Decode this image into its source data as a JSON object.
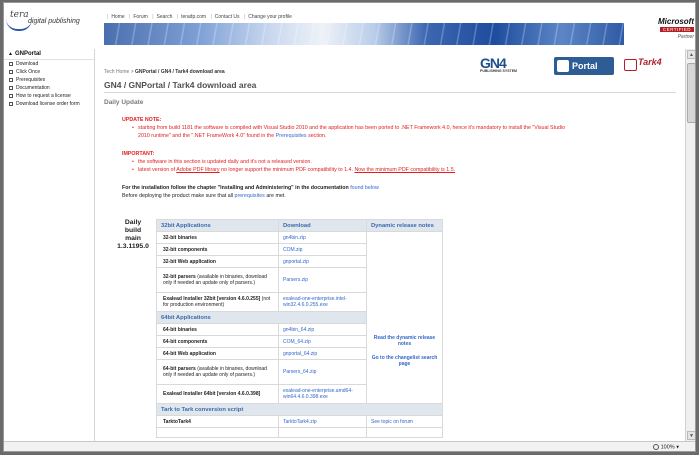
{
  "header": {
    "logo_top": "tera",
    "logo_bottom": "digital publishing",
    "nav": [
      "Home",
      "Forum",
      "Search",
      "teradp.com",
      "Contact Us",
      "Change your profile"
    ],
    "ms_brand": "Microsoft",
    "ms_certified": "CERTIFIED",
    "ms_partner": "Partner"
  },
  "sidebar": {
    "title": "GNPortal",
    "items": [
      "Download",
      "Click Once",
      "Prerequisites",
      "Documentation",
      "How to request a license",
      "Download license order form"
    ]
  },
  "breadcrumb": {
    "root": "Tech Home",
    "sep": ">",
    "current": "GNPortal / GN4 / Tark4 download area"
  },
  "product_logos": {
    "gn4": "GN4",
    "gn4_sub": "PUBLISHING SYSTEM",
    "portal": "Portal",
    "tark": "Tark4"
  },
  "page": {
    "title": "GN4 / GNPortal / Tark4 download area",
    "subtitle": "Daily Update"
  },
  "update_note": {
    "heading": "UPDATE NOTE:",
    "line1_pre": "starting from build 1181 the software is compiled with Visual Studio 2010 and the application has been ported to .NET Framework 4.0, hence it's mandatory to install the \"Visual Studio",
    "line2_pre": "2010 runtime\" and the \".NET FrameWork 4.0\" found in the",
    "line2_link": "Prerequisites",
    "line2_post": "section."
  },
  "important": {
    "heading": "IMPORTANT:",
    "item1": "the software in this section is updated daily and it's not a released version.",
    "item2_pre": "latest version of",
    "item2_link": "Adobe PDF library",
    "item2_mid": "no longer support the minimum PDF compatibility to 1.4.",
    "item2_underlined": "Now the minimum PDF compatibility is 1.5."
  },
  "instructions": {
    "line1": "For the installation follow the chapter \"Installing and Administering\" in the documentation",
    "line1_link": "found below",
    "line2_pre": "Before deploying the product make sure that all",
    "line2_link": "prerequisites",
    "line2_post": "are met."
  },
  "daily_build": {
    "line1": "Daily",
    "line2": "build",
    "line3": "main",
    "version": "1.3.1195.0"
  },
  "downloads": {
    "col_apps": "32bit Applications",
    "col_download": "Download",
    "col_notes": "Dynamic release notes",
    "notes_link1": "Read the dynamic release notes",
    "notes_link2": "Go to the changelist search page",
    "rows32": [
      {
        "label": "32-bit binaries",
        "note": "",
        "file": "gn4bin.zip"
      },
      {
        "label": "32-bit components",
        "note": "",
        "file": "COM.zip"
      },
      {
        "label": "32-bit Web application",
        "note": "",
        "file": "gnportal.zip"
      },
      {
        "label": "32-bit parsers",
        "note": "(available in binaries, download only if needed an update only of parsers.)",
        "file": "Parsers.zip"
      },
      {
        "label": "Exalead Installer 32bit [version 4.6.0.255]",
        "note": "(not for production environment)",
        "file": "exalead-one-enterprise.intel-win32.4.6.0.255.exe"
      }
    ],
    "section64": "64bit Applications",
    "rows64": [
      {
        "label": "64-bit binaries",
        "note": "",
        "file": "gn4bin_64.zip"
      },
      {
        "label": "64-bit components",
        "note": "",
        "file": "COM_64.zip"
      },
      {
        "label": "64-bit Web application",
        "note": "",
        "file": "gnportal_64.zip"
      },
      {
        "label": "64-bit parsers",
        "note": "(available in binaries, download only if needed an update only of parsers.)",
        "file": "Parsers_64.zip"
      },
      {
        "label": "Exalead Installer 64bit [version 4.6.0.398]",
        "note": "",
        "file": "exalead-one-enterprise.amd64-win64.4.6.0.398.exe"
      }
    ],
    "section_tark": "Tark to Tark conversion script",
    "tark_row": {
      "label": "TarktoTark4",
      "file": "TarktoTark4.zip",
      "topic": "See topic on forum"
    }
  },
  "statusbar": {
    "zoom": "100%"
  }
}
